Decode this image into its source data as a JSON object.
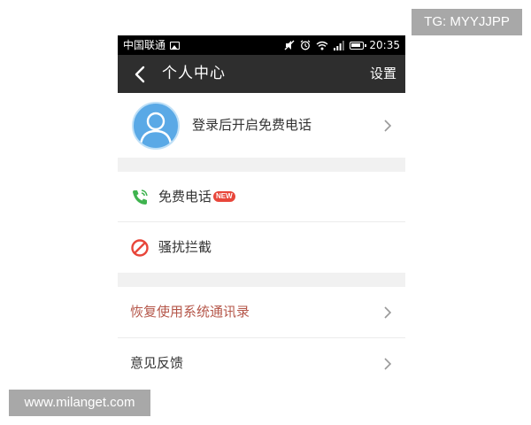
{
  "watermarks": {
    "top": "TG: MYYJJPP",
    "bottom": "www.milanget.com"
  },
  "status_bar": {
    "carrier": "中国联通",
    "time": "20:35"
  },
  "nav": {
    "title": "个人中心",
    "settings_label": "设置",
    "back_icon": "chevron-left-icon"
  },
  "profile": {
    "login_prompt": "登录后开启免费电话",
    "avatar_icon": "avatar-placeholder-icon"
  },
  "menu": {
    "free_call": {
      "label": "免费电话",
      "badge": "NEW",
      "icon": "phone-icon"
    },
    "block": {
      "label": "骚扰拦截",
      "icon": "block-icon"
    },
    "restore_contacts": {
      "label": "恢复使用系统通讯录"
    },
    "feedback": {
      "label": "意见反馈"
    }
  },
  "colors": {
    "nav_bg": "#2e2e2e",
    "accent_red": "#e8463a",
    "phone_green": "#3fb34f",
    "avatar_blue": "#5aa9e6",
    "restore_text": "#b5574a"
  }
}
